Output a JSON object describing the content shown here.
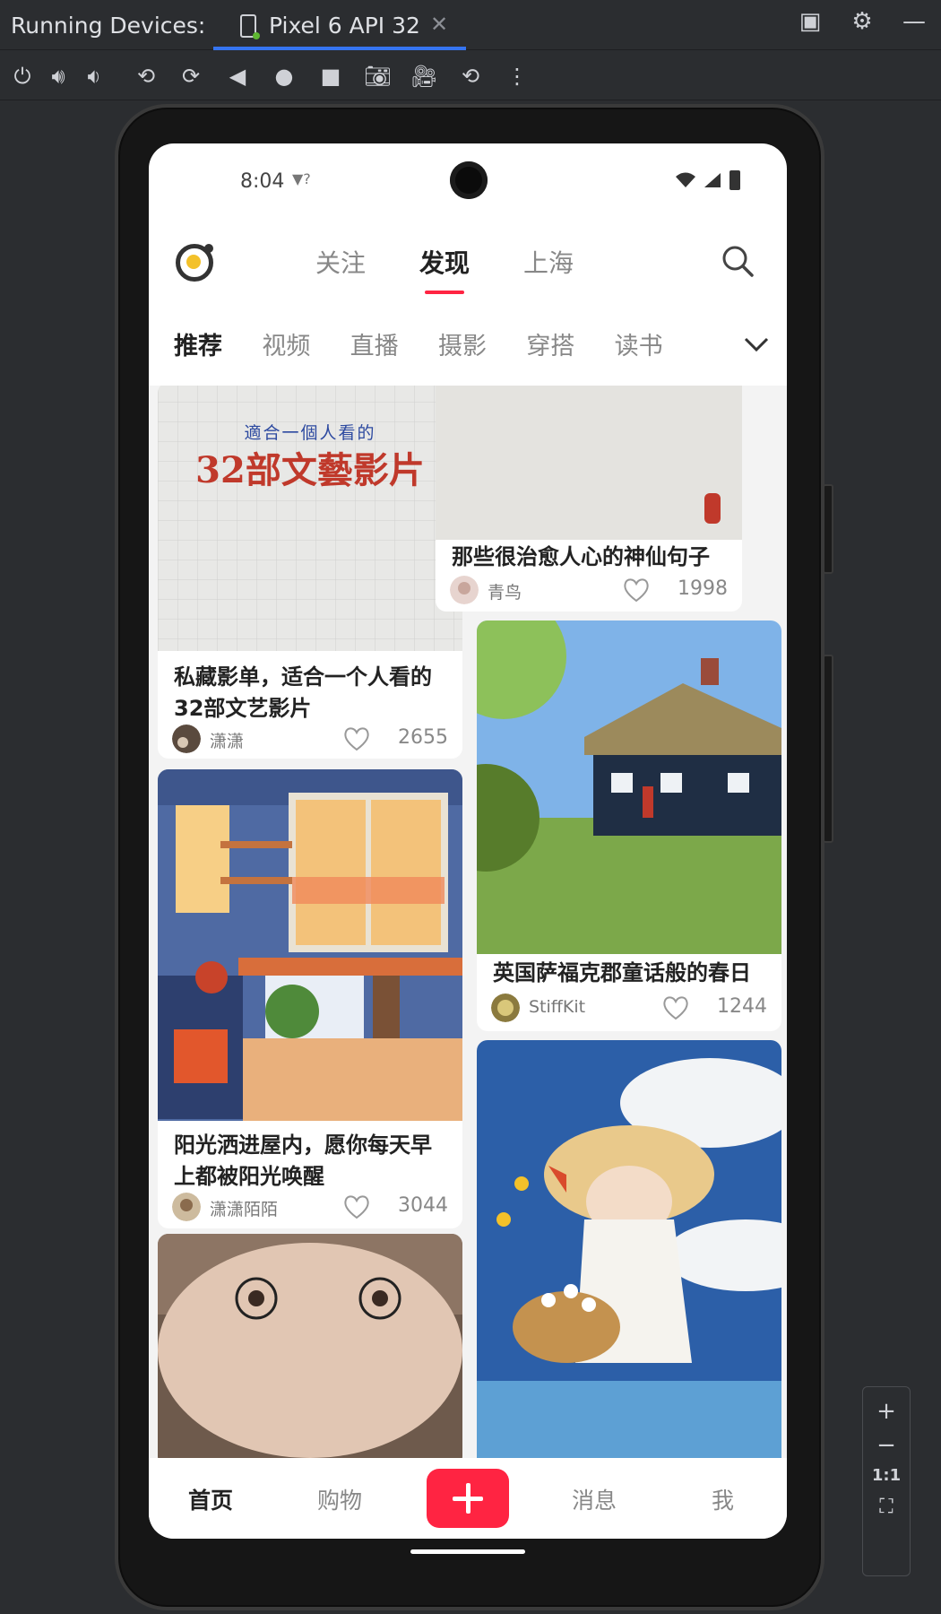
{
  "ide": {
    "panel_title": "Running Devices:",
    "device_tab": "Pixel 6 API 32",
    "zoom": {
      "plus": "+",
      "minus": "−",
      "ratio": "1:1"
    }
  },
  "status_bar": {
    "time": "8:04"
  },
  "top_nav": {
    "tabs": [
      "关注",
      "发现",
      "上海"
    ],
    "active": "发现"
  },
  "categories": {
    "items": [
      "推荐",
      "视频",
      "直播",
      "摄影",
      "穿搭",
      "读书"
    ],
    "active": "推荐"
  },
  "feed": {
    "left": [
      {
        "cover_line1": "適合一個人看的",
        "cover_line2": "32部文藝影片",
        "title": "私藏影单，适合一个人看的32部文艺影片",
        "author": "潇潇",
        "likes": "2655"
      },
      {
        "title": "阳光洒进屋内，愿你每天早上都被阳光唤醒",
        "author": "潇潇陌陌",
        "likes": "3044"
      }
    ],
    "right": [
      {
        "title": "那些很治愈人心的神仙句子",
        "author": "青鸟",
        "likes": "1998"
      },
      {
        "title": "英国萨福克郡童话般的春日",
        "author": "StiffKit",
        "likes": "1244"
      }
    ]
  },
  "bottom_nav": {
    "items": [
      "首页",
      "购物",
      "消息",
      "我"
    ],
    "active": "首页"
  },
  "colors": {
    "accent": "#ff2442",
    "ide_bg": "#2b2d30",
    "ide_tab_underline": "#3574f0"
  }
}
